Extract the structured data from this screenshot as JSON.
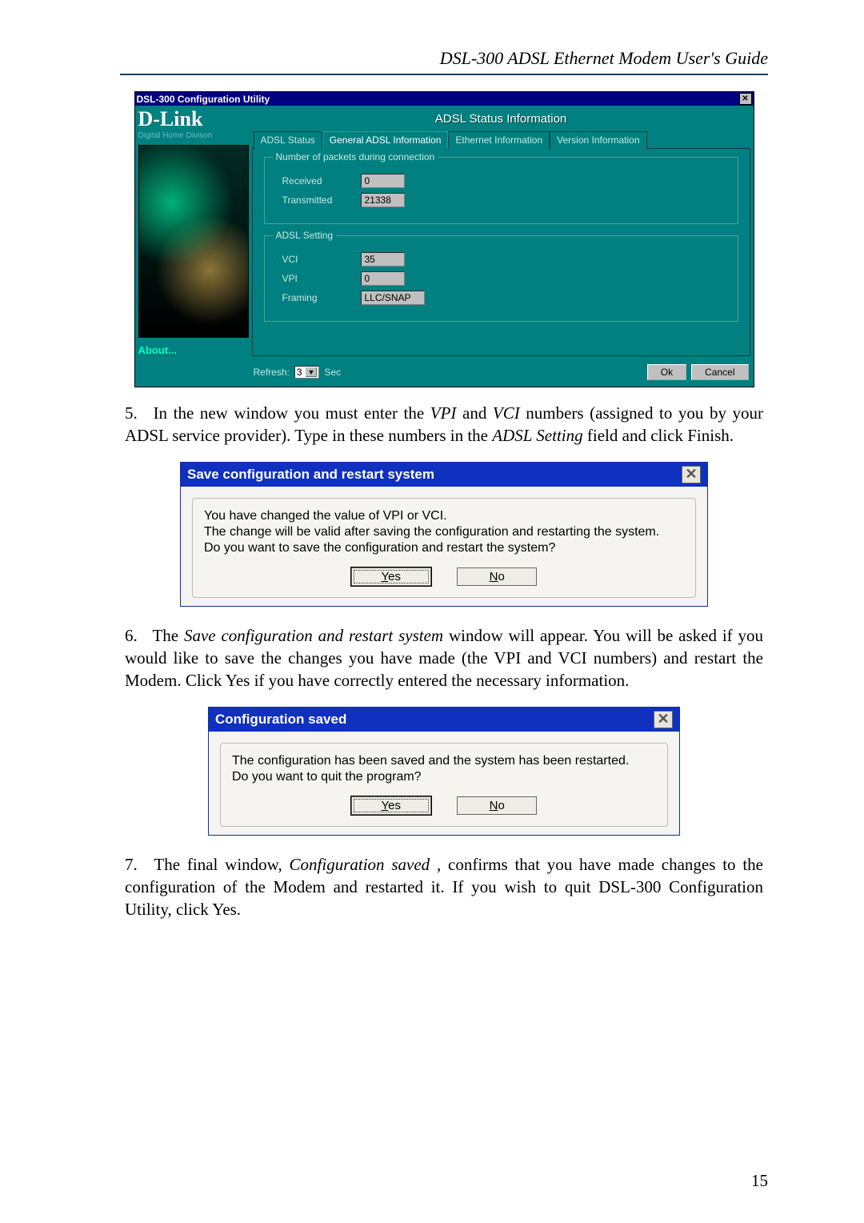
{
  "running_head": "DSL-300 ADSL Ethernet Modem User's Guide",
  "page_number": "15",
  "config_window": {
    "title": "DSL-300 Configuration Utility",
    "brand": "D-Link",
    "brand_sub": "Digital Home Divison",
    "about": "About...",
    "banner": "ADSL Status Information",
    "tabs": {
      "adsl_status": "ADSL Status",
      "general": "General ADSL Information",
      "ethernet": "Ethernet Information",
      "version": "Version Information"
    },
    "group_packets": {
      "title": "Number of packets during connection",
      "received_label": "Received",
      "received_value": "0",
      "transmitted_label": "Transmitted",
      "transmitted_value": "21338"
    },
    "group_adsl": {
      "title": "ADSL Setting",
      "vci_label": "VCI",
      "vci_value": "35",
      "vpi_label": "VPI",
      "vpi_value": "0",
      "framing_label": "Framing",
      "framing_value": "LLC/SNAP"
    },
    "refresh_label": "Refresh:",
    "refresh_value": "3",
    "refresh_unit": "Sec",
    "ok": "Ok",
    "cancel": "Cancel"
  },
  "step5": {
    "num": "5.",
    "text_a": "In the new window you must enter the ",
    "vpi": "VPI",
    "text_b": " and ",
    "vci": "VCI",
    "text_c": " numbers (assigned to you by your ADSL service provider). Type in these numbers in the ",
    "adsl_setting": "ADSL Setting",
    "text_d": " field and click Finish."
  },
  "dialog_save": {
    "title": "Save configuration and restart system",
    "line1": "You have changed the value of VPI or VCI.",
    "line2": "The change will be valid after saving the configuration and restarting the system.",
    "line3": "Do you want to save the configuration and restart the system?",
    "yes_u": "Y",
    "yes_rest": "es",
    "no_u": "N",
    "no_rest": "o"
  },
  "step6": {
    "num": "6.",
    "text_a": "The ",
    "ital": "Save configuration and restart system",
    "text_b": " window will appear. You will be asked if you would like to save the changes you have made (the VPI and VCI numbers) and restart the Modem. Click Yes if you have correctly entered the necessary information."
  },
  "dialog_saved": {
    "title": "Configuration saved",
    "line1": "The configuration has been saved and the system has been restarted.",
    "line2": "Do you want to quit the program?",
    "yes_u": "Y",
    "yes_rest": "es",
    "no_u": "N",
    "no_rest": "o"
  },
  "step7": {
    "num": "7.",
    "text_a": "The final window, ",
    "ital": "Configuration saved",
    "text_b": ", confirms that you have made changes to the configuration of the Modem and restarted it. If you wish to quit DSL-300 Configuration Utility, click Yes."
  }
}
